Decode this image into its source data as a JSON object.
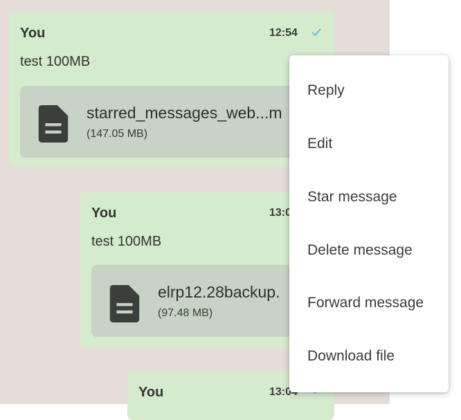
{
  "colors": {
    "chat_background": "#e6ddd8",
    "bubble": "#d5ebcd",
    "file_card": "#c7d3c5",
    "check": "#5fb7e0",
    "menu_background": "#ffffff"
  },
  "messages": [
    {
      "sender": "You",
      "time": "12:54",
      "status_icon": "check-icon",
      "text": "test 100MB",
      "file": {
        "icon": "document-icon",
        "name": "starred_messages_web...m",
        "size": "(147.05 MB)"
      }
    },
    {
      "sender": "You",
      "time": "13:0",
      "text": "test 100MB",
      "file": {
        "icon": "document-icon",
        "name": "elrp12.28backup.",
        "size": "(97.48 MB)"
      }
    },
    {
      "sender": "You",
      "time": "13:04",
      "status_icon": "check-icon"
    }
  ],
  "context_menu": {
    "items": [
      "Reply",
      "Edit",
      "Star message",
      "Delete message",
      "Forward message",
      "Download file"
    ]
  }
}
